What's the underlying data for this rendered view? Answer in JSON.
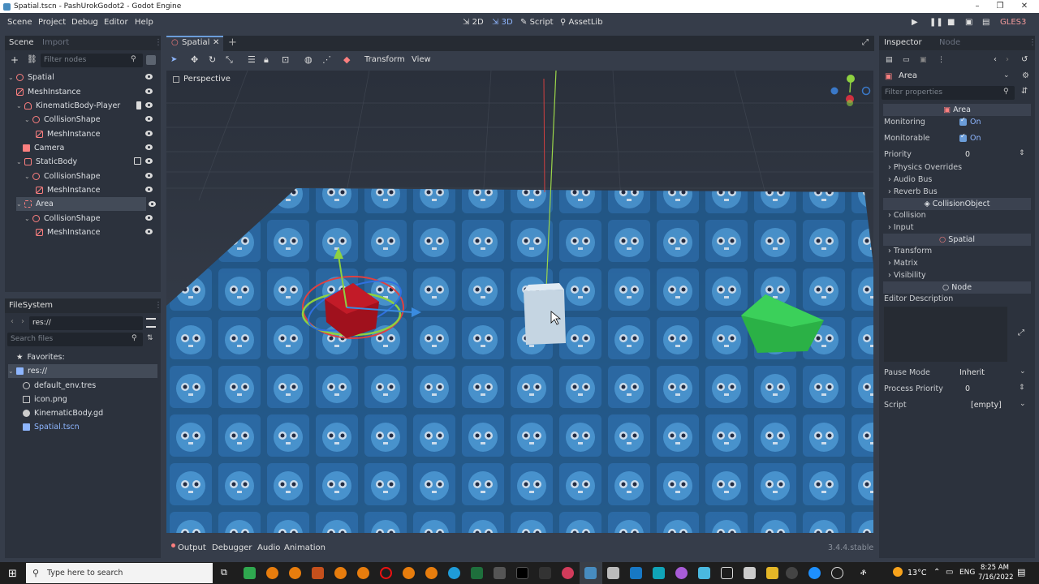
{
  "window": {
    "title": "Spatial.tscn - PashUrokGodot2 - Godot Engine"
  },
  "menu": {
    "items": [
      "Scene",
      "Project",
      "Debug",
      "Editor",
      "Help"
    ],
    "workspaces": {
      "two_d": "2D",
      "three_d": "3D",
      "script": "Script",
      "assetlib": "AssetLib"
    },
    "renderer": "GLES3"
  },
  "scene_dock": {
    "tab_scene": "Scene",
    "tab_import": "Import",
    "filter_placeholder": "Filter nodes",
    "nodes": [
      {
        "label": "Spatial"
      },
      {
        "label": "MeshInstance"
      },
      {
        "label": "KinematicBody-Player"
      },
      {
        "label": "CollisionShape"
      },
      {
        "label": "MeshInstance"
      },
      {
        "label": "Camera"
      },
      {
        "label": "StaticBody"
      },
      {
        "label": "CollisionShape"
      },
      {
        "label": "MeshInstance"
      },
      {
        "label": "Area"
      },
      {
        "label": "CollisionShape"
      },
      {
        "label": "MeshInstance"
      }
    ]
  },
  "filesystem": {
    "title": "FileSystem",
    "path": "res://",
    "search_placeholder": "Search files",
    "favorites": "Favorites:",
    "root": "res://",
    "files": [
      "default_env.tres",
      "icon.png",
      "KinematicBody.gd",
      "Spatial.tscn"
    ]
  },
  "editor": {
    "tab": "Spatial",
    "toolbar_transform": "Transform",
    "toolbar_view": "View",
    "perspective": "Perspective"
  },
  "inspector": {
    "tab_inspector": "Inspector",
    "tab_node": "Node",
    "object": "Area",
    "filter_placeholder": "Filter properties",
    "sections": {
      "area": "Area",
      "collision_object": "CollisionObject",
      "spatial": "Spatial",
      "node": "Node"
    },
    "monitoring_label": "Monitoring",
    "monitoring_value": "On",
    "monitorable_label": "Monitorable",
    "monitorable_value": "On",
    "priority_label": "Priority",
    "priority_value": "0",
    "groups_area": [
      "Physics Overrides",
      "Audio Bus",
      "Reverb Bus"
    ],
    "groups_collision": [
      "Collision",
      "Input"
    ],
    "groups_spatial": [
      "Transform",
      "Matrix",
      "Visibility"
    ],
    "editor_description": "Editor Description",
    "pause_mode_label": "Pause Mode",
    "pause_mode_value": "Inherit",
    "process_priority_label": "Process Priority",
    "process_priority_value": "0",
    "script_label": "Script",
    "script_value": "[empty]"
  },
  "bottom": {
    "output": "Output",
    "debugger": "Debugger",
    "audio": "Audio",
    "animation": "Animation",
    "version": "3.4.4.stable"
  },
  "taskbar": {
    "search_placeholder": "Type here to search",
    "weather": "13°C",
    "lang": "ENG",
    "time": "8:25 AM",
    "date": "7/16/2022"
  },
  "colors": {
    "accent": "#6b9dd9",
    "node_icon": "#fc7f7f",
    "viewport_tile": "#3a78b0"
  }
}
